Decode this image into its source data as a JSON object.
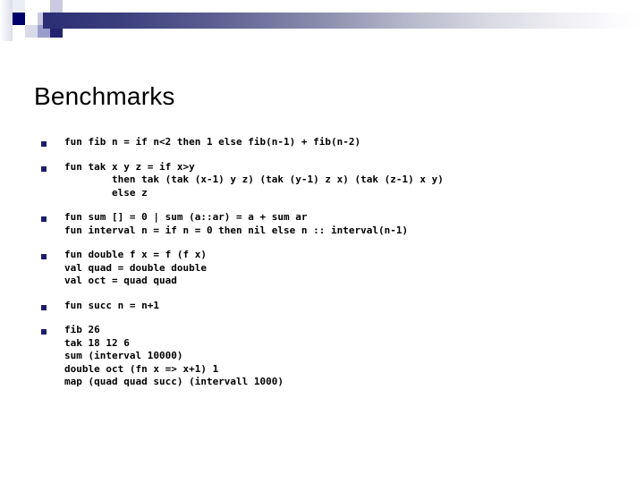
{
  "slide": {
    "title": "Benchmarks",
    "decoration": {
      "gradient_start_color": "#2b2e74",
      "gradient_end_color": "#ffffff",
      "accent_dark": "#00006b",
      "accent_mid": "#9a9ccc",
      "accent_light": "#c9cadf",
      "accent_pale": "#e6e7f1"
    },
    "bullet_color": "#1d1d6b",
    "bullets": [
      {
        "name": "fib",
        "lines": [
          "fun fib n = if n<2 then 1 else fib(n-1) + fib(n-2)"
        ]
      },
      {
        "name": "tak",
        "lines": [
          "fun tak x y z = if x>y",
          "        then tak (tak (x-1) y z) (tak (y-1) z x) (tak (z-1) x y)",
          "        else z"
        ]
      },
      {
        "name": "sum-interval",
        "lines": [
          "fun sum [] = 0 | sum (a::ar) = a + sum ar",
          "fun interval n = if n = 0 then nil else n :: interval(n-1)"
        ]
      },
      {
        "name": "double-quad-oct",
        "lines": [
          "fun double f x = f (f x)",
          "val quad = double double",
          "val oct = quad quad"
        ]
      },
      {
        "name": "succ",
        "lines": [
          "fun succ n = n+1"
        ]
      },
      {
        "name": "benchmark-invocations",
        "lines": [
          "fib 26",
          "tak 18 12 6",
          "sum (interval 10000)",
          "double oct (fn x => x+1) 1",
          "map (quad quad succ) (intervall 1000)"
        ]
      }
    ]
  }
}
